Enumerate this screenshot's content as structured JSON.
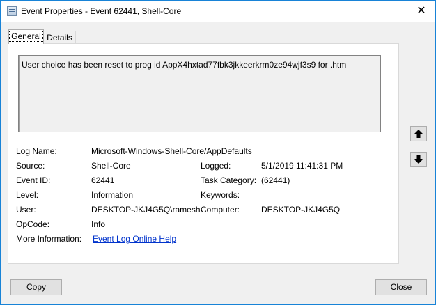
{
  "window": {
    "title": "Event Properties - Event 62441, Shell-Core"
  },
  "tabs": [
    {
      "label": "General",
      "selected": true
    },
    {
      "label": "Details",
      "selected": false
    }
  ],
  "general": {
    "description": "User choice has been reset to prog id AppX4hxtad77fbk3jkkeerkrm0ze94wjf3s9 for .htm",
    "fields": {
      "log_name_label": "Log Name:",
      "log_name_value": "Microsoft-Windows-Shell-Core/AppDefaults",
      "source_label": "Source:",
      "source_value": "Shell-Core",
      "logged_label": "Logged:",
      "logged_value": "5/1/2019 11:41:31 PM",
      "event_id_label": "Event ID:",
      "event_id_value": "62441",
      "task_category_label": "Task Category:",
      "task_category_value": "(62441)",
      "level_label": "Level:",
      "level_value": "Information",
      "keywords_label": "Keywords:",
      "keywords_value": "",
      "user_label": "User:",
      "user_value": "DESKTOP-JKJ4G5Q\\ramesh",
      "computer_label": "Computer:",
      "computer_value": "DESKTOP-JKJ4G5Q",
      "opcode_label": "OpCode:",
      "opcode_value": "Info",
      "more_info_label": "More Information:",
      "more_info_link": "Event Log Online Help"
    }
  },
  "buttons": {
    "copy": "Copy",
    "close": "Close"
  },
  "icons": {
    "title": "event-properties-icon",
    "close": "close-icon",
    "up": "arrow-up-icon",
    "down": "arrow-down-icon"
  }
}
